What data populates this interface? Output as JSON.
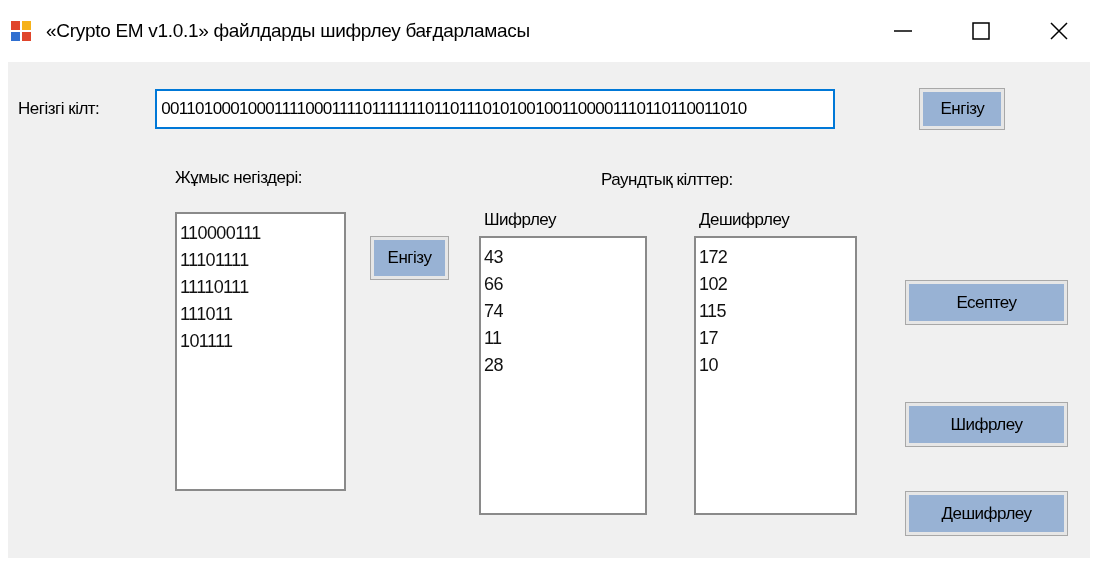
{
  "window": {
    "title": "«Crypto EM v1.0.1»  файлдарды шифрлеу бағдарламасы"
  },
  "key": {
    "label": "Негізгі кілт:",
    "value": "0011010001000111100011110111111101101110101001001100001110110110011010",
    "button": "Енгізу"
  },
  "bases": {
    "label": "Жұмыс негіздері:",
    "items": [
      "110000111",
      "11101111",
      "11110111",
      "111011",
      "101111"
    ],
    "button": "Енгізу"
  },
  "round_keys": {
    "label": "Раундтық кілттер:",
    "lists": [
      {
        "label": "Шифрлеу",
        "items": [
          "43",
          "66",
          "74",
          "11",
          "28"
        ]
      },
      {
        "label": "Дешифрлеу",
        "items": [
          "172",
          "102",
          "115",
          "17",
          "10"
        ]
      }
    ]
  },
  "actions": [
    "Есептеу",
    "Шифрлеу",
    "Дешифрлеу"
  ]
}
